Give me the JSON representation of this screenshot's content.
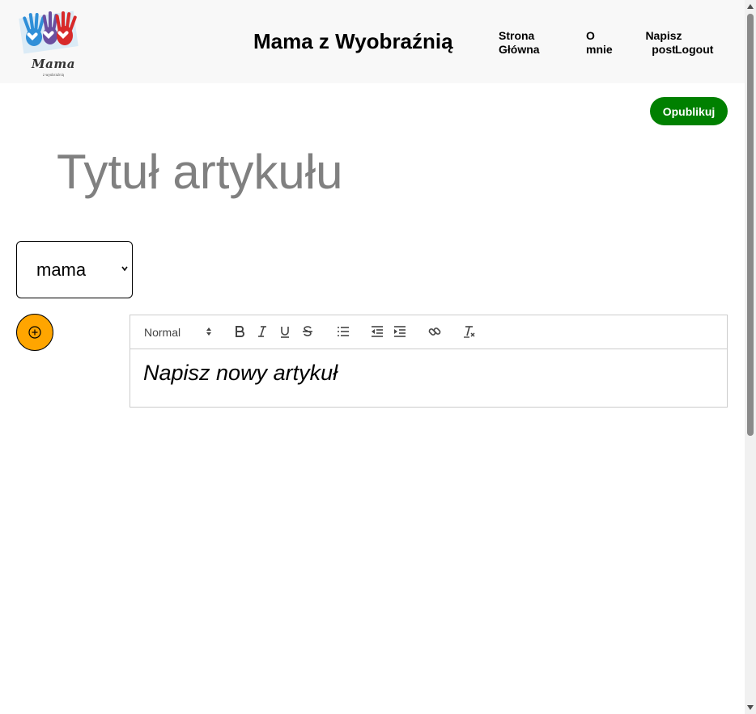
{
  "header": {
    "logo_text": "Mama",
    "logo_subtext": "z wyobraźnią",
    "site_title": "Mama z Wyobraźnią",
    "nav": {
      "home": "Strona Główna",
      "about": "O mnie",
      "write": "Napisz post",
      "logout": "Logout"
    }
  },
  "actions": {
    "publish_label": "Opublikuj"
  },
  "title_input": {
    "placeholder": "Tytuł artykułu"
  },
  "category": {
    "selected": "mama"
  },
  "editor": {
    "format": "Normal",
    "body_text": "Napisz nowy artykuł",
    "toolbar_icons": [
      "bold-icon",
      "italic-icon",
      "underline-icon",
      "strikethrough-icon",
      "bullet-list-icon",
      "outdent-icon",
      "indent-icon",
      "link-icon",
      "clear-format-icon"
    ]
  },
  "colors": {
    "publish": "#008000",
    "add_button": "#ffa500",
    "header_bg": "#f8f8f8",
    "title_placeholder": "#808080"
  }
}
